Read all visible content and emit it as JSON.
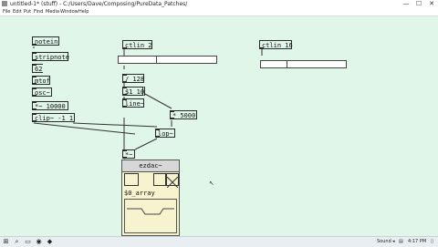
{
  "window": {
    "title": "untitled-1* (stuff) - C:/Users/Dave/Composing/PureData_Patches/",
    "minimize_glyph": "—",
    "maximize_glyph": "☐",
    "close_glyph": "✕"
  },
  "menubar": [
    "File",
    "Edit",
    "Put",
    "Find",
    "Media",
    "Window",
    "Help"
  ],
  "objects": {
    "notein": "notein",
    "stripnote": "stripnote",
    "num62": "62",
    "mtof": "mtof",
    "osc": "osc~",
    "mul10000": "*~ 10000",
    "clip": "clip~ -1 1",
    "ctlin2": "ctlin 2",
    "ctlin16": "ctlin 16",
    "div128": "/ 128",
    "msg_s1_10": "$1 10",
    "line": "line~",
    "mul5000": "* 5000",
    "lop": "lop~",
    "mul": "*~",
    "ezdac": "ezdac~",
    "array": "$0_array"
  },
  "sliders": {
    "slider1_value": 0.39,
    "slider2_value": 0.3
  },
  "taskbar": {
    "tray_label": "Sound",
    "time": "4:17 PM",
    "start_glyph": "⊞",
    "search_glyph": "⌕",
    "explorer_glyph": "▭",
    "browser_glyph": "◉",
    "pd_glyph": "◆",
    "volume_glyph": "◂",
    "network_glyph": "▤",
    "show_desktop_glyph": "▯"
  },
  "colors": {
    "canvas": "#dff6e9",
    "gop": "#f7f3cf",
    "taskbar": "#e9eef3"
  }
}
